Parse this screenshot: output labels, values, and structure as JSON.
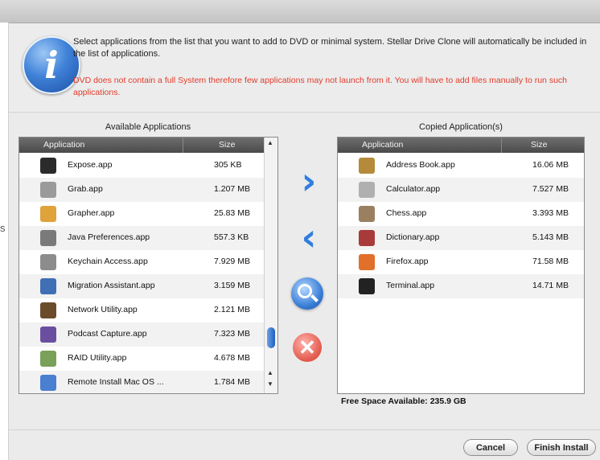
{
  "stray_char": "s",
  "header": {
    "message": "Select applications from the list that you want to add to DVD or minimal system. Stellar Drive Clone will automatically be included in the list of applications.",
    "warning": "DVD does not contain a full System therefore few applications may not launch from it. You will have to add files manually to run such applications."
  },
  "available": {
    "title": "Available Applications",
    "col_app": "Application",
    "col_size": "Size",
    "rows": [
      {
        "name": "Expose.app",
        "size": "305 KB"
      },
      {
        "name": "Grab.app",
        "size": "1.207 MB"
      },
      {
        "name": "Grapher.app",
        "size": "25.83 MB"
      },
      {
        "name": "Java Preferences.app",
        "size": "557.3 KB"
      },
      {
        "name": "Keychain Access.app",
        "size": "7.929 MB"
      },
      {
        "name": "Migration Assistant.app",
        "size": "3.159 MB"
      },
      {
        "name": "Network Utility.app",
        "size": "2.121 MB"
      },
      {
        "name": "Podcast Capture.app",
        "size": "7.323 MB"
      },
      {
        "name": "RAID Utility.app",
        "size": "4.678 MB"
      },
      {
        "name": "Remote Install Mac OS ...",
        "size": "1.784 MB"
      }
    ]
  },
  "copied": {
    "title": "Copied Application(s)",
    "col_app": "Application",
    "col_size": "Size",
    "rows": [
      {
        "name": "Address Book.app",
        "size": "16.06 MB"
      },
      {
        "name": "Calculator.app",
        "size": "7.527 MB"
      },
      {
        "name": "Chess.app",
        "size": "3.393 MB"
      },
      {
        "name": "Dictionary.app",
        "size": "5.143 MB"
      },
      {
        "name": "Firefox.app",
        "size": "71.58 MB"
      },
      {
        "name": "Terminal.app",
        "size": "14.71 MB"
      }
    ]
  },
  "free_space": "Free Space Available: 235.9 GB",
  "buttons": {
    "add": "›",
    "remove": "‹",
    "clear": "✕",
    "cancel": "Cancel",
    "finish": "Finish Install"
  },
  "icons": {
    "info": "i",
    "available": [
      "expose-icon",
      "grab-icon",
      "grapher-icon",
      "java-preferences-icon",
      "keychain-access-icon",
      "migration-assistant-icon",
      "network-utility-icon",
      "podcast-capture-icon",
      "raid-utility-icon",
      "remote-install-icon"
    ],
    "copied": [
      "address-book-icon",
      "calculator-icon",
      "chess-icon",
      "dictionary-icon",
      "firefox-icon",
      "terminal-icon"
    ]
  },
  "colors": {
    "warning_text": "#e23b2a",
    "list_header": "#595959",
    "arrow_blue": "#2f7ee0",
    "clear_red": "#e2574a"
  }
}
